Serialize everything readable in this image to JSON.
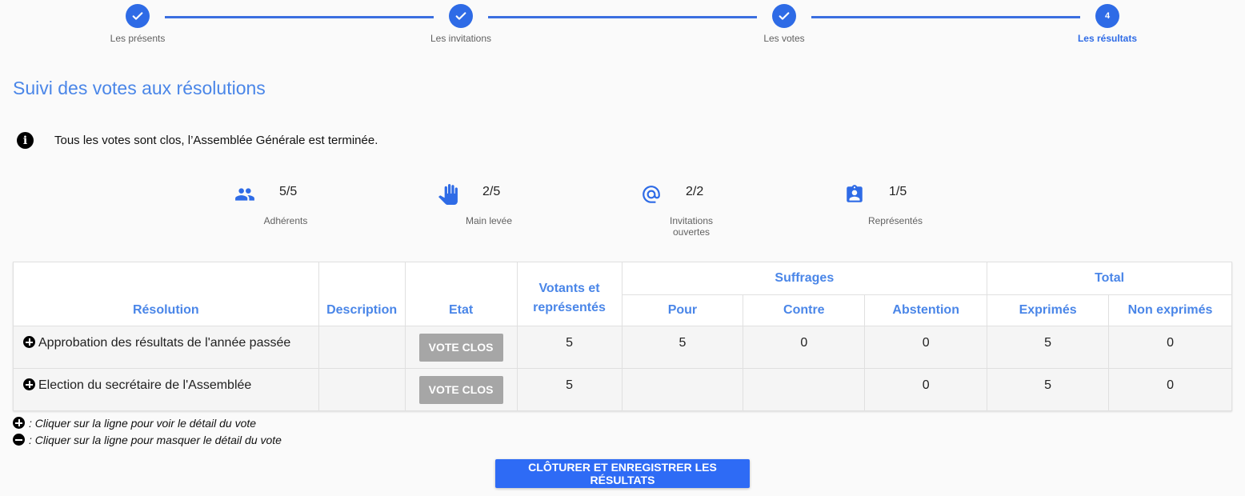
{
  "stepper": {
    "steps": [
      {
        "label": "Les présents",
        "state": "done"
      },
      {
        "label": "Les invitations",
        "state": "done"
      },
      {
        "label": "Les votes",
        "state": "done"
      },
      {
        "label": "Les résultats",
        "state": "active",
        "number": "4"
      }
    ]
  },
  "page": {
    "title": "Suivi des votes aux résolutions",
    "info_message": "Tous les votes sont clos, l’Assemblée Générale est terminée."
  },
  "stats": [
    {
      "icon": "people-icon",
      "value": "5/5",
      "label": "Adhérents"
    },
    {
      "icon": "raised-hand-icon",
      "value": "2/5",
      "label": "Main levée"
    },
    {
      "icon": "at-sign-icon",
      "value": "2/2",
      "label": "Invitations ouvertes"
    },
    {
      "icon": "assignment-ind-icon",
      "value": "1/5",
      "label": "Représentés"
    }
  ],
  "table": {
    "headers": {
      "resolution": "Résolution",
      "description": "Description",
      "etat": "Etat",
      "votants": "Votants et représentés",
      "suffrages": "Suffrages",
      "total": "Total",
      "pour": "Pour",
      "contre": "Contre",
      "abstention": "Abstention",
      "exprimes": "Exprimés",
      "non_exprimes": "Non exprimés"
    },
    "rows": [
      {
        "resolution": "Approbation des résultats de l'année passée",
        "description": "",
        "etat": "VOTE CLOS",
        "votants": "5",
        "pour": "5",
        "contre": "0",
        "abstention": "0",
        "exprimes": "5",
        "non_exprimes": "0"
      },
      {
        "resolution": "Election du secrétaire de l'Assemblée",
        "description": "",
        "etat": "VOTE CLOS",
        "votants": "5",
        "pour": "",
        "contre": "",
        "abstention": "0",
        "exprimes": "5",
        "non_exprimes": "0"
      }
    ]
  },
  "legend": {
    "expand": ": Cliquer sur la ligne pour voir le détail du vote",
    "collapse": ": Cliquer sur la ligne pour masquer le détail du vote"
  },
  "actions": {
    "submit_label": "Clôturer et enregistrer les résultats"
  },
  "colors": {
    "accent": "#2e6be6",
    "header_text": "#4a86e8",
    "closed_button": "#a6a6a6",
    "submit_button": "#2e6bf5"
  }
}
